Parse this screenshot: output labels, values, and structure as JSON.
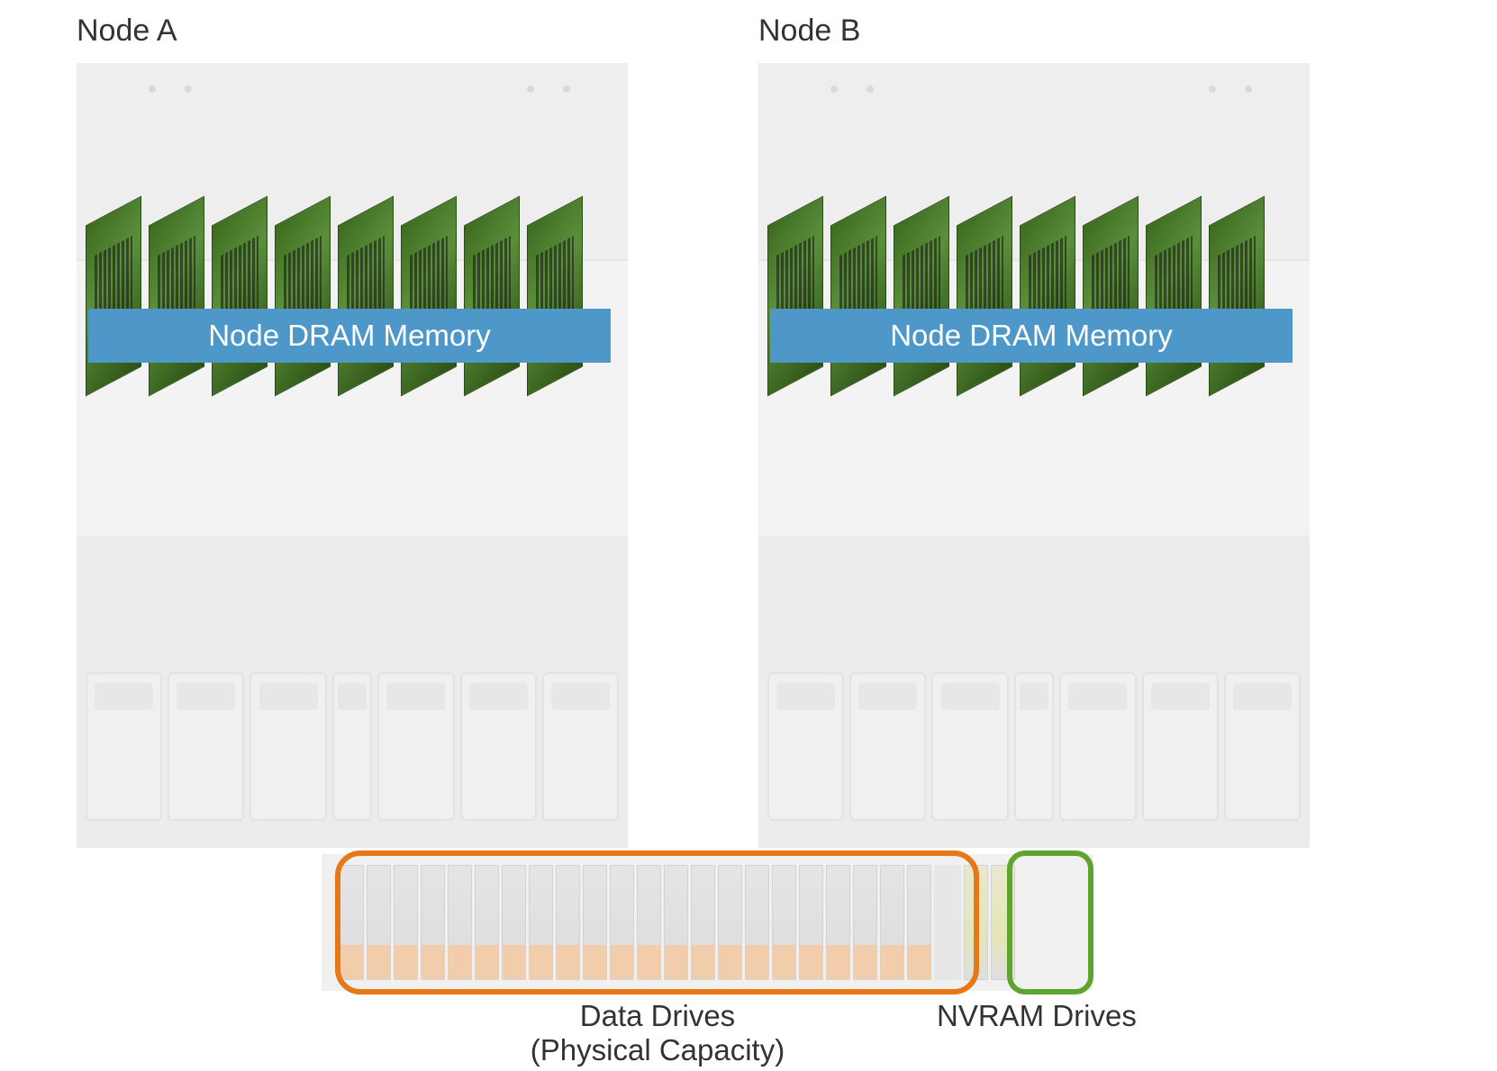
{
  "node_a": {
    "title": "Node A",
    "dram_label": "Node DRAM Memory"
  },
  "node_b": {
    "title": "Node B",
    "dram_label": "Node DRAM Memory"
  },
  "drives": {
    "data_label_line1": "Data Drives",
    "data_label_line2": "(Physical Capacity)",
    "nvram_label": "NVRAM Drives"
  },
  "diagram_meta": {
    "dimm_count_per_node": 8,
    "data_drive_count": 22,
    "nvram_drive_count": 2,
    "colors": {
      "dram_band": "#4d98c9",
      "data_drives_outline": "#e77817",
      "nvram_drives_outline": "#5ea52e"
    }
  }
}
